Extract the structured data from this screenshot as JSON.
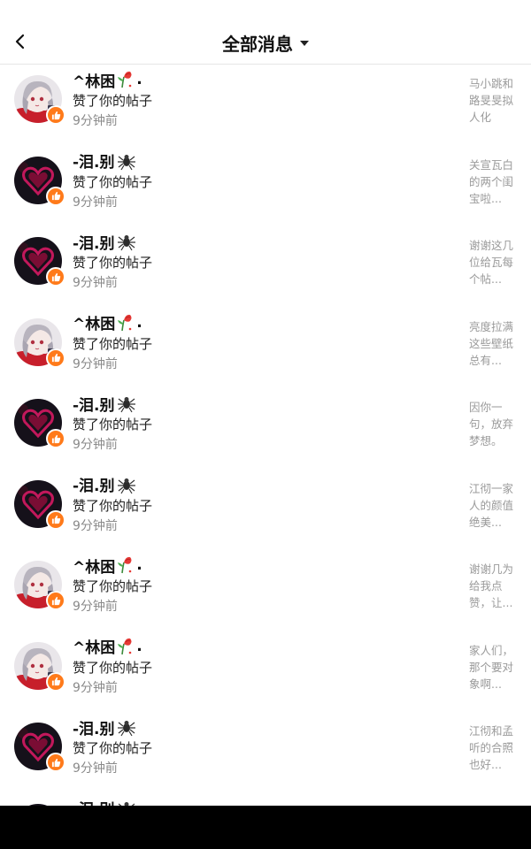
{
  "header": {
    "title": "全部消息",
    "back_icon": "chevron-left-icon",
    "dropdown_icon": "caret-down-icon"
  },
  "users": {
    "lin": {
      "name": "^林困",
      "suffix": ".",
      "avatar": "anime-girl-avatar",
      "emoji": "rose-icon"
    },
    "lei": {
      "name": "-泪.别",
      "suffix": "",
      "avatar": "dark-heart-avatar",
      "emoji": "spider-icon"
    }
  },
  "colors": {
    "like_badge": "#ff7a1a",
    "meta_text": "#8a8a8a",
    "snippet_text": "#9a9a9a"
  },
  "notifications": [
    {
      "user": "lin",
      "name": "^林困",
      "suffix": ".",
      "action": "赞了你的帖子",
      "time": "9分钟前",
      "snippet": "马小跳和路旻旻拟人化"
    },
    {
      "user": "lei",
      "name": "-泪.别",
      "suffix": "",
      "action": "赞了你的帖子",
      "time": "9分钟前",
      "snippet": "关宣瓦白的两个闺宝啦..."
    },
    {
      "user": "lei",
      "name": "-泪.别",
      "suffix": "",
      "action": "赞了你的帖子",
      "time": "9分钟前",
      "snippet": "谢谢这几位给瓦每个帖..."
    },
    {
      "user": "lin",
      "name": "^林困",
      "suffix": ".",
      "action": "赞了你的帖子",
      "time": "9分钟前",
      "snippet": "亮度拉满这些壁纸总有..."
    },
    {
      "user": "lei",
      "name": "-泪.别",
      "suffix": "",
      "action": "赞了你的帖子",
      "time": "9分钟前",
      "snippet": "因你一句，放弃梦想。"
    },
    {
      "user": "lei",
      "name": "-泪.别",
      "suffix": "",
      "action": "赞了你的帖子",
      "time": "9分钟前",
      "snippet": "江彻一家人的颜值绝美..."
    },
    {
      "user": "lin",
      "name": "^林困",
      "suffix": ".",
      "action": "赞了你的帖子",
      "time": "9分钟前",
      "snippet": "谢谢几为给我点赞，让..."
    },
    {
      "user": "lin",
      "name": "^林困",
      "suffix": ".",
      "action": "赞了你的帖子",
      "time": "9分钟前",
      "snippet": "家人们，那个要对象啊..."
    },
    {
      "user": "lei",
      "name": "-泪.别",
      "suffix": "",
      "action": "赞了你的帖子",
      "time": "9分钟前",
      "snippet": "江彻和孟听的合照也好..."
    },
    {
      "user": "lei",
      "name": "-泪.别",
      "suffix": "",
      "action": "",
      "time": "",
      "snippet": ""
    }
  ]
}
